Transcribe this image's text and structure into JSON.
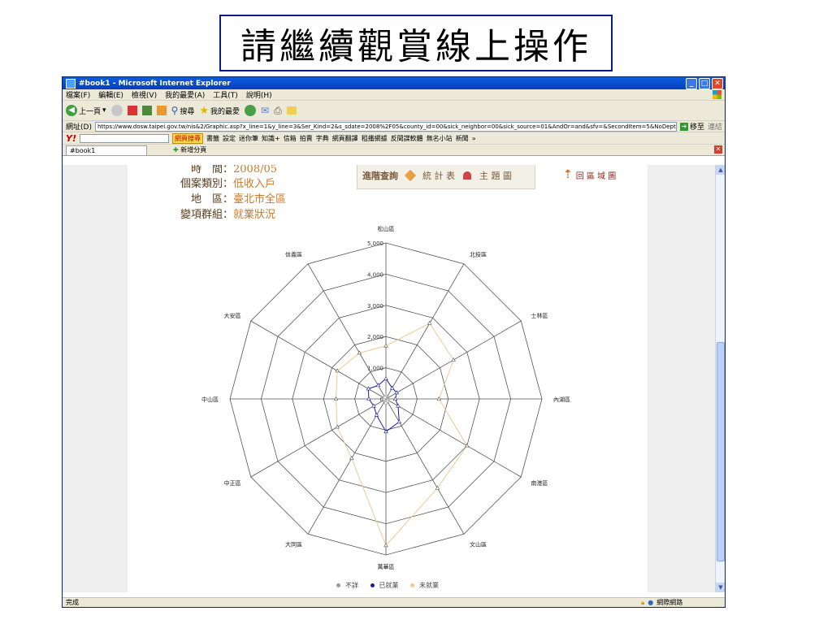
{
  "slide": {
    "title": "請繼續觀賞線上操作"
  },
  "window": {
    "title": "#book1 - Microsoft Internet Explorer",
    "menu": [
      "檔案(F)",
      "編輯(E)",
      "檢視(V)",
      "我的最愛(A)",
      "工具(T)",
      "說明(H)"
    ],
    "toolbar": {
      "back": "上一頁",
      "search": "搜尋",
      "favorites": "我的最愛"
    },
    "address_label": "網址(D)",
    "address": "https://www.dosw.taipei.gov.tw/nis&2/Graphic.asp?x_line=1&y_line=3&Ser_Kind=2&s_sdate=2008%2F05&county_id=00&sick_neighbor=00&sick_source=01&AndOr=and&sfv=&SecondItem=5&NoDept=000&NoSource=000&Chil",
    "goto_label": "移至",
    "links_label": "連結",
    "yahoo_bar": {
      "logo": "Y!",
      "search_btn": "網頁搜尋",
      "items": [
        "書籤",
        "設定",
        "迷你筆",
        "知識+",
        "信箱",
        "拍賣",
        "字典",
        "網頁翻譯",
        "租播網據",
        "反間諜軟體",
        "無名小站",
        "新聞",
        "»"
      ]
    },
    "tab_label": "#book1",
    "new_tab_label": "新增分頁",
    "status": "完成",
    "zone": "網際網路"
  },
  "page": {
    "info": [
      {
        "label": "時　間：",
        "value": "2008/05"
      },
      {
        "label": "個案類別：",
        "value": "低收入戶"
      },
      {
        "label": "地　區：",
        "value": "臺北市全區"
      },
      {
        "label": "變項群組：",
        "value": "就業狀況"
      }
    ],
    "buttons": {
      "advanced": "進階查詢",
      "stats": "統 計 表",
      "theme": "主 題 圖",
      "home": "回 區 域 圖"
    }
  },
  "chart_data": {
    "type": "radar",
    "categories": [
      "松山區",
      "北投區",
      "士林區",
      "內湖區",
      "南港區",
      "文山區",
      "萬華區",
      "大同區",
      "中正區",
      "中山區",
      "大安區",
      "信義區"
    ],
    "rlim": [
      0,
      5000
    ],
    "ticks": [
      0,
      1000,
      2000,
      3000,
      4000,
      5000
    ],
    "tick_labels": [
      "0",
      "1,000",
      "2,000",
      "3,000",
      "4,000",
      "5,000"
    ],
    "series": [
      {
        "name": "不詳",
        "color": "#9a9a9a",
        "values": [
          100,
          80,
          60,
          50,
          60,
          80,
          120,
          60,
          40,
          60,
          80,
          60
        ]
      },
      {
        "name": "已就業",
        "color": "#1a1aa0",
        "values": [
          650,
          400,
          400,
          300,
          450,
          850,
          1050,
          600,
          450,
          550,
          650,
          500
        ]
      },
      {
        "name": "未就業",
        "color": "#f0c890",
        "values": [
          1700,
          2800,
          2500,
          1700,
          3000,
          3300,
          4700,
          2200,
          1800,
          1600,
          1800,
          1700
        ]
      }
    ],
    "grid": true,
    "legend": "bottom-center"
  },
  "colors": {
    "label": "#5a3a1a",
    "value": "#c87a2a",
    "title_border": "#0a1a8c",
    "grid": "#555555"
  },
  "icons": [
    "ie-logo-icon",
    "windows-flag-icon",
    "back-icon",
    "forward-icon",
    "stop-icon",
    "refresh-icon",
    "home-icon",
    "search-icon",
    "favorites-star-icon",
    "history-icon",
    "mail-icon",
    "print-icon",
    "go-arrow-icon",
    "lock-icon",
    "globe-icon"
  ]
}
